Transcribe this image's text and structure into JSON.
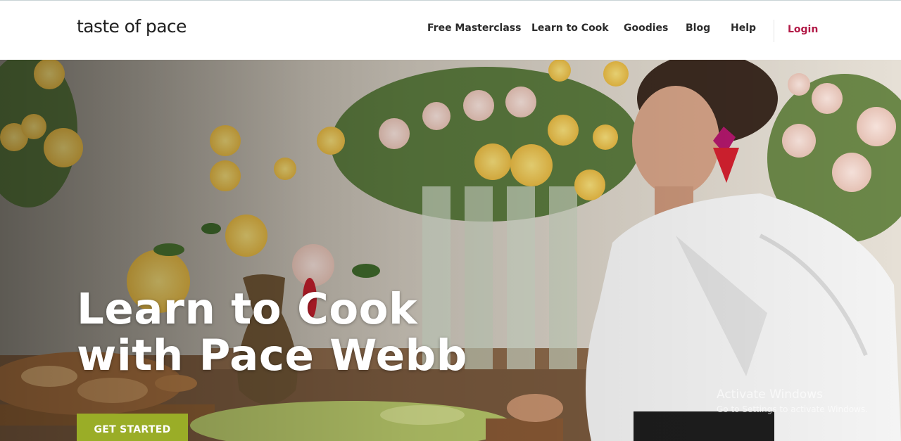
{
  "header": {
    "logo": "taste of pace",
    "nav": [
      {
        "label": "Free Masterclass"
      },
      {
        "label": "Learn to Cook"
      },
      {
        "label": "Goodies"
      },
      {
        "label": "Blog"
      },
      {
        "label": "Help"
      }
    ],
    "login": "Login"
  },
  "hero": {
    "title_line1": "Learn to Cook",
    "title_line2": "with Pace Webb",
    "cta": "GET STARTED"
  },
  "watermark": {
    "title": "Activate Windows",
    "subtitle": "Go to Settings to activate Windows."
  },
  "colors": {
    "accent_green": "#9aad27",
    "login_red": "#b21a47",
    "nav_text": "#2b2b2b"
  }
}
